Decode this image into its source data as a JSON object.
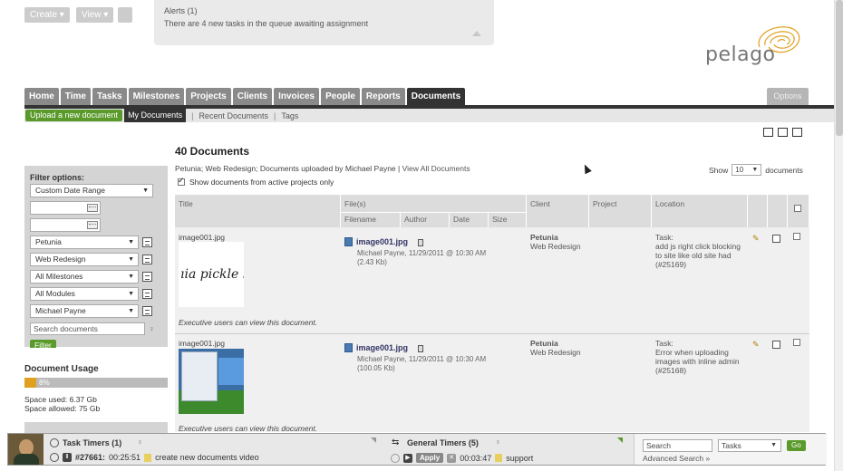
{
  "toolbar": {
    "create_label": "Create ▾",
    "view_label": "View ▾"
  },
  "alerts": {
    "title": "Alerts (1)",
    "text": "There are 4 new tasks in the queue awaiting assignment"
  },
  "brand": {
    "name": "pelago",
    "accent": "#e0a020"
  },
  "nav": {
    "tabs": [
      "Home",
      "Time",
      "Tasks",
      "Milestones",
      "Projects",
      "Clients",
      "Invoices",
      "People",
      "Reports",
      "Documents"
    ],
    "active_tab": "Documents",
    "options_label": "Options"
  },
  "subnav": {
    "upload_label": "Upload a new document",
    "items": [
      "My Documents",
      "Recent Documents",
      "Tags"
    ]
  },
  "page": {
    "title": "40 Documents",
    "breadcrumb": "Petunia; Web Redesign; Documents uploaded by Michael Payne",
    "view_all": "View All Documents",
    "show_label": "Show",
    "show_value": "10",
    "show_suffix": "documents",
    "active_projects_label": "Show documents from active projects only"
  },
  "filters": {
    "title": "Filter options:",
    "date_range": "Custom Date Range",
    "selects": [
      "Petunia",
      "Web Redesign",
      "All Milestones",
      "All Modules",
      "Michael Payne"
    ],
    "search_placeholder": "Search documents",
    "filter_label": "Filter"
  },
  "usage": {
    "title": "Document Usage",
    "percent": 8,
    "percent_label": "8%",
    "used": "Space used: 6.37 Gb",
    "allowed": "Space allowed: 75 Gb"
  },
  "table": {
    "columns": {
      "title": "Title",
      "files": "File(s)",
      "client": "Client",
      "project": "Project",
      "location": "Location"
    },
    "subcolumns": [
      "Filename",
      "Author",
      "Date",
      "Size"
    ],
    "rows": [
      {
        "title": "image001.jpg",
        "thumb_text": "ıia pickle bo",
        "filename": "image001.jpg",
        "meta1": "Michael Payne, 11/29/2011 @ 10:30 AM",
        "meta2": "(2.43 Kb)",
        "client": "Petunia",
        "client_project": "Web Redesign",
        "loc_label": "Task:",
        "loc_text": "add js right click blocking to site like old site had (#25169)",
        "note": "Executive users can view this document."
      },
      {
        "title": "image001.jpg",
        "filename": "image001.jpg",
        "meta1": "Michael Payne, 11/29/2011 @ 10:30 AM",
        "meta2": "(100.05 Kb)",
        "client": "Petunia",
        "client_project": "Web Redesign",
        "loc_label": "Task:",
        "loc_text": "Error when uploading images with inline admin (#25168)",
        "note": "Executive users can view this document."
      }
    ]
  },
  "bottom": {
    "task_timers": "Task Timers (1)",
    "task_id": "#27661:",
    "task_time": "00:25:51",
    "task_name": "create new documents video",
    "general_timers": "General Timers (5)",
    "apply_label": "Apply",
    "general_time": "00:03:47",
    "general_name": "support",
    "search_value": "Search",
    "search_scope": "Tasks",
    "go_label": "Go",
    "advanced": "Advanced Search »"
  }
}
